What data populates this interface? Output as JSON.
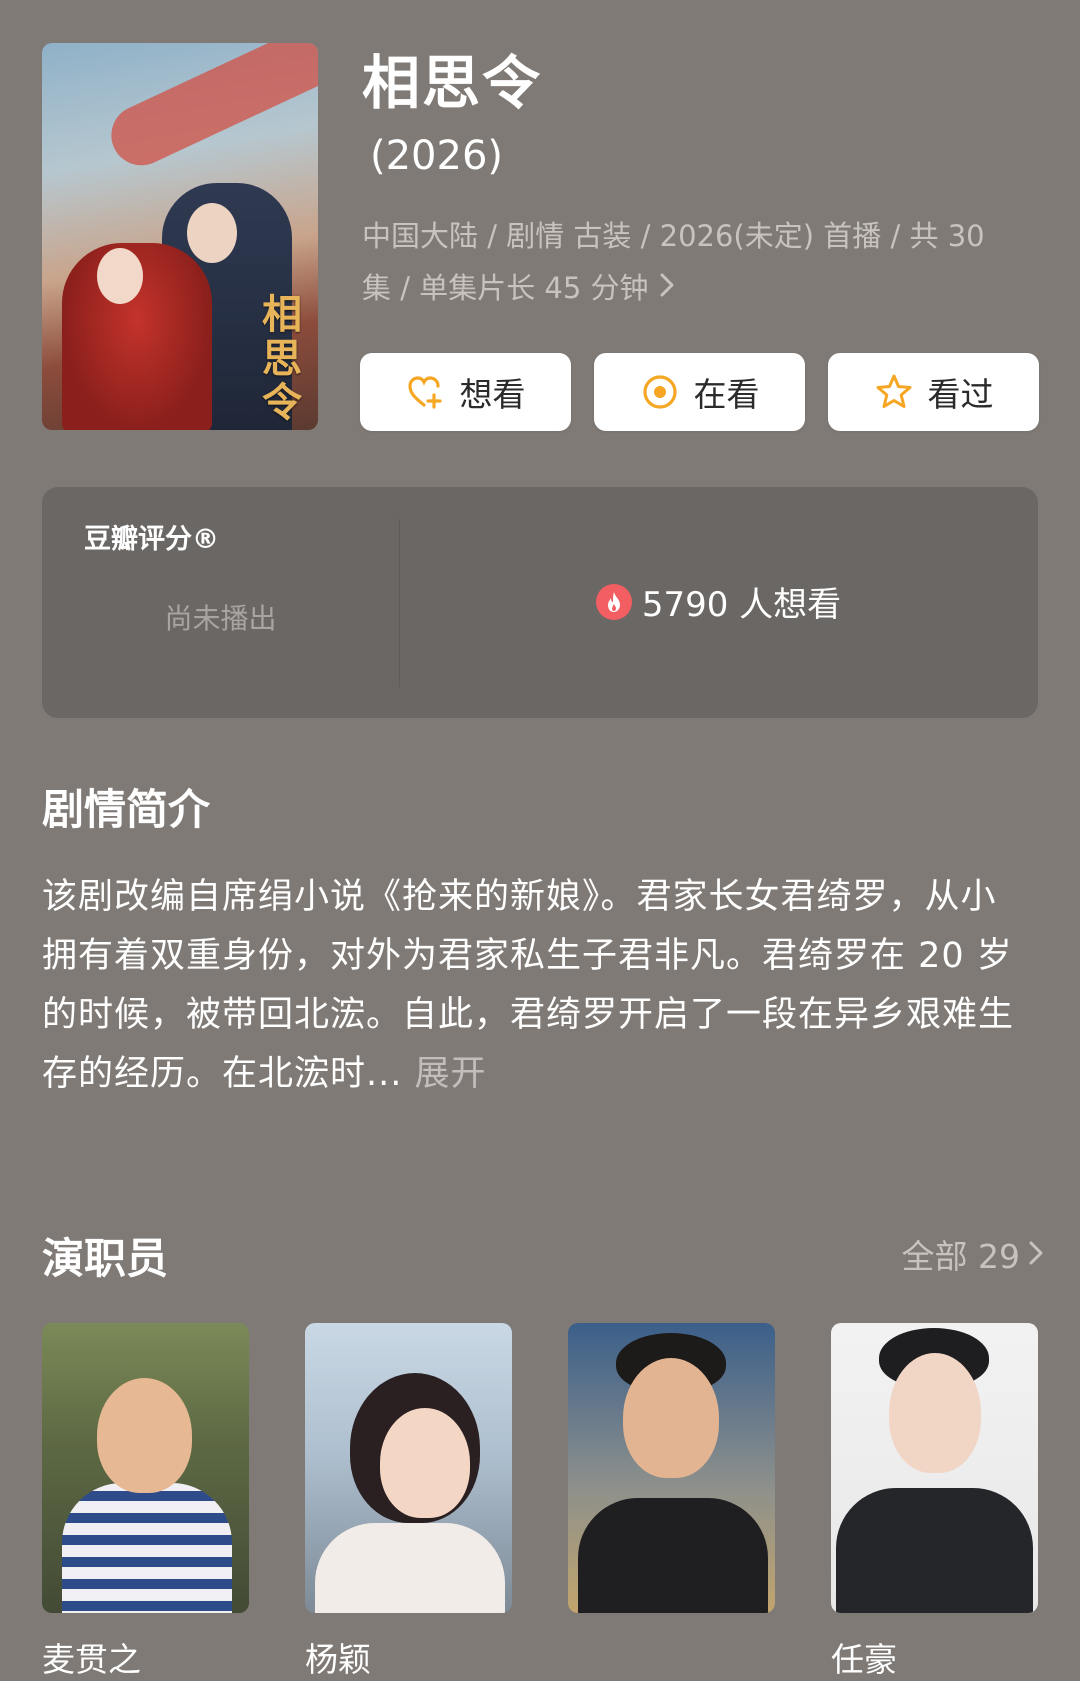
{
  "header": {
    "poster_title": "相思令",
    "title": "相思令",
    "year": "(2026)",
    "meta": "中国大陆 / 剧情 古装 / 2026(未定) 首播 / 共 30 集 / 单集片长 45 分钟",
    "meta_chevron_icon": "chevron-right-icon"
  },
  "actions": {
    "want": {
      "label": "想看",
      "icon": "heart-plus-icon",
      "color": "#f5a623"
    },
    "watching": {
      "label": "在看",
      "icon": "target-circle-icon",
      "color": "#f5a623"
    },
    "watched": {
      "label": "看过",
      "icon": "star-icon",
      "color": "#f5a623"
    }
  },
  "rating": {
    "label": "豆瓣评分®",
    "status": "尚未播出",
    "wish_count": "5790 人想看",
    "fire_icon": "fire-icon",
    "fire_color": "#f25e61"
  },
  "synopsis": {
    "title": "剧情简介",
    "text": "该剧改编自席绢小说《抢来的新娘》。君家长女君绮罗，从小拥有着双重身份，对外为君家私生子君非凡。君绮罗在 20 岁的时候，被带回北浤。自此，君绮罗开启了一段在异乡艰难生存的经历。在北浤时...",
    "expand_label": "展开"
  },
  "cast": {
    "title": "演职员",
    "all_label": "全部 29",
    "members": [
      {
        "name": "麦贯之"
      },
      {
        "name": "杨颖"
      },
      {
        "name": ""
      },
      {
        "name": "任豪"
      }
    ]
  },
  "colors": {
    "background": "#7f7a76",
    "card": "#6b6764",
    "accent": "#f5a623"
  }
}
